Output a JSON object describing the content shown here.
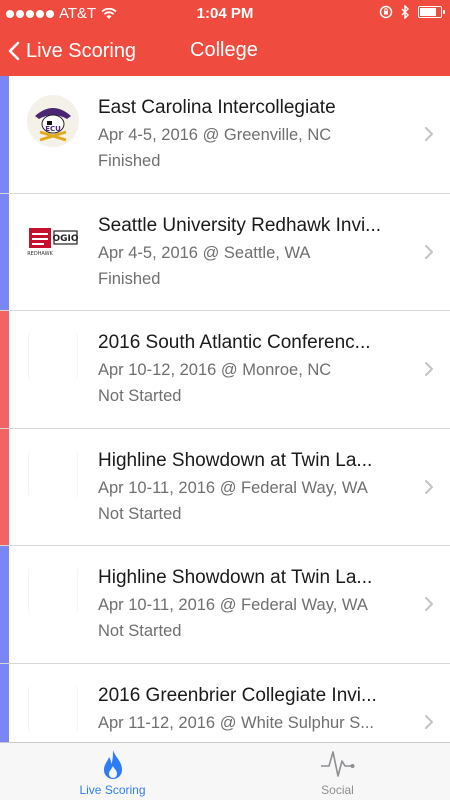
{
  "status_bar": {
    "carrier": "AT&T",
    "time": "1:04 PM"
  },
  "nav": {
    "back_label": "Live Scoring",
    "title": "College"
  },
  "colors": {
    "accent": "#f04b3f",
    "stripe_blue": "#7b86f5",
    "stripe_red": "#f26464",
    "tab_active": "#2f7df6",
    "tab_inactive": "#8e8e93"
  },
  "events": [
    {
      "title": "East Carolina Intercollegiate",
      "subtitle": "Apr 4-5, 2016 @ Greenville, NC",
      "status": "Finished",
      "stripe": "blue",
      "logo": "ecu-pirate-logo"
    },
    {
      "title": "Seattle University Redhawk Invi...",
      "subtitle": "Apr 4-5, 2016 @ Seattle, WA",
      "status": "Finished",
      "stripe": "blue",
      "logo": "seattle-ogio-logo"
    },
    {
      "title": "2016 South Atlantic Conferenc...",
      "subtitle": "Apr 10-12, 2016 @ Monroe, NC",
      "status": "Not Started",
      "stripe": "red",
      "logo": "blank-logo"
    },
    {
      "title": "Highline Showdown at Twin La...",
      "subtitle": "Apr 10-11, 2016 @ Federal Way, WA",
      "status": "Not Started",
      "stripe": "red",
      "logo": "blank-logo"
    },
    {
      "title": "Highline Showdown at Twin La...",
      "subtitle": "Apr 10-11, 2016 @ Federal Way, WA",
      "status": "Not Started",
      "stripe": "blue",
      "logo": "blank-logo"
    },
    {
      "title": "2016 Greenbrier Collegiate Invi...",
      "subtitle": "Apr 11-12, 2016 @ White Sulphur S...",
      "status": "",
      "stripe": "blue",
      "logo": "blank-logo"
    }
  ],
  "tabs": [
    {
      "label": "Live Scoring",
      "icon": "flame-icon",
      "active": true
    },
    {
      "label": "Social",
      "icon": "pulse-icon",
      "active": false
    }
  ]
}
